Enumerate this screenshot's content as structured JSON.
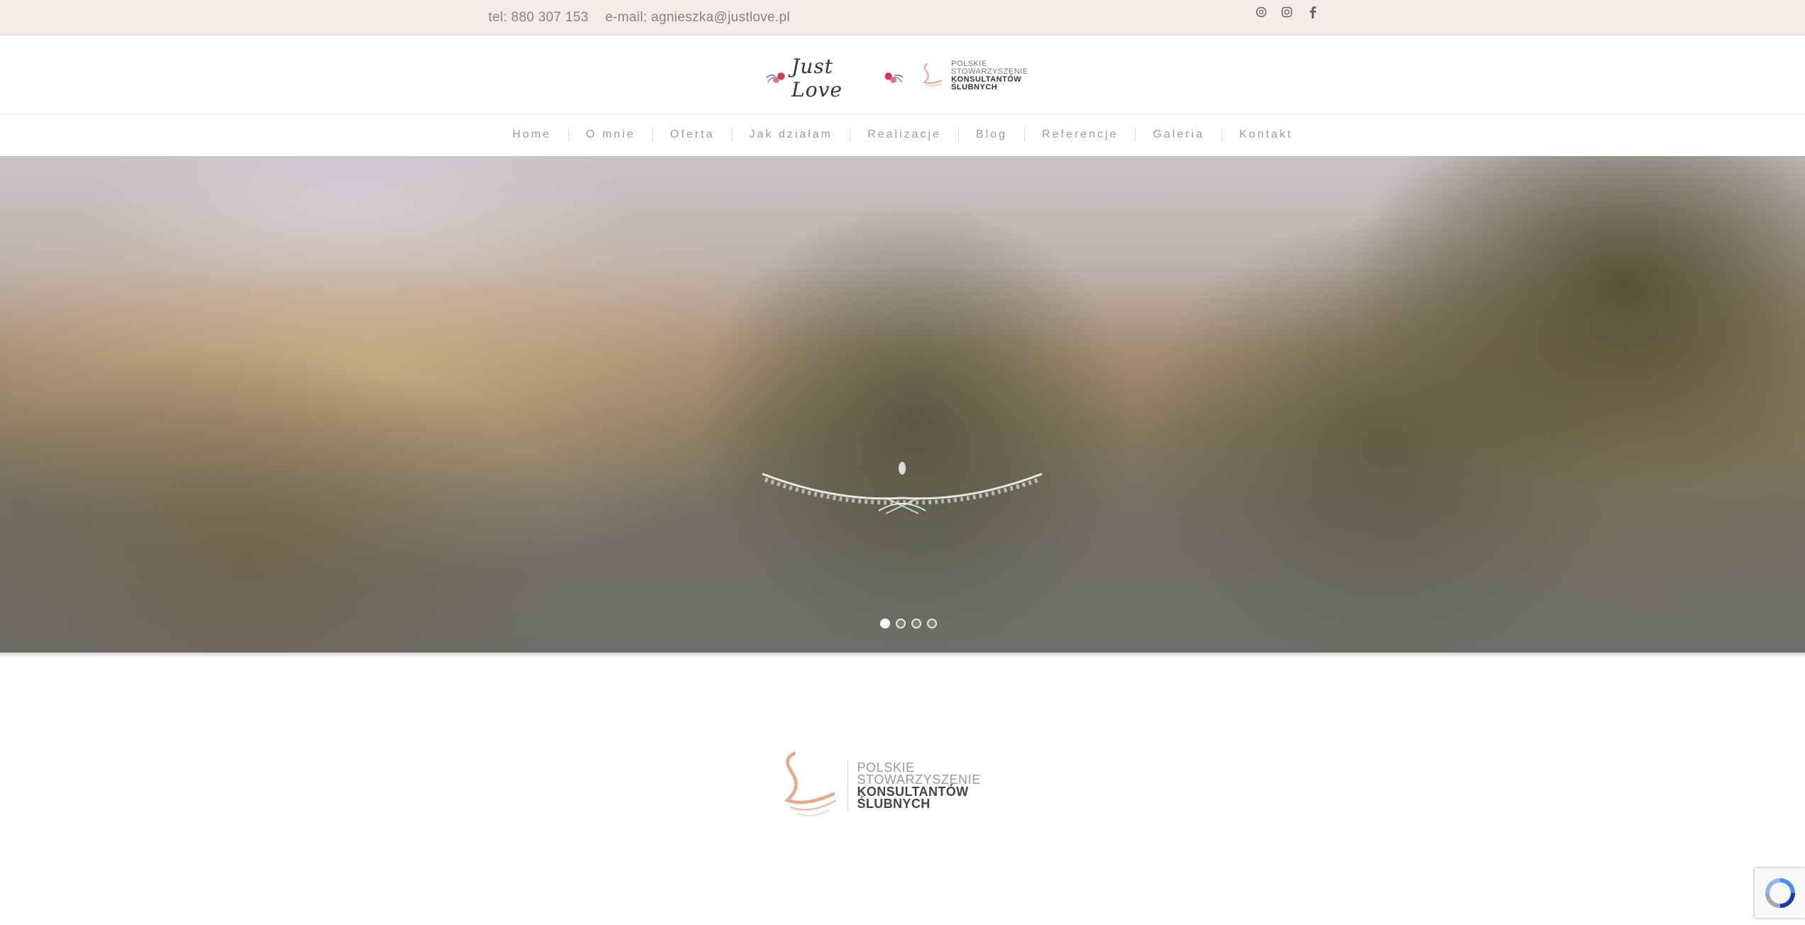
{
  "topbar": {
    "phone": "tel: 880 307 153",
    "email": "e-mail: agnieszka@justlove.pl",
    "social_icons": [
      "globe-icon",
      "instagram-icon",
      "facebook-icon"
    ]
  },
  "header": {
    "logo_text": "Just Love",
    "partner_logo_lines": [
      "POLSKIE STOWARZYSZENIE",
      "KONSULTANTÓW",
      "ŚLUBNYCH"
    ]
  },
  "nav": {
    "items": [
      "Home",
      "O mnie",
      "Oferta",
      "Jak działam",
      "Realizacje",
      "Blog",
      "Referencje",
      "Galeria",
      "Kontakt"
    ]
  },
  "slider": {
    "slide_count": 4,
    "active_index": 0
  },
  "footer_logo": {
    "line1": "POLSKIE STOWARZYSZENIE",
    "line2": "KONSULTANTÓW",
    "line3": "ŚLUBNYCH"
  },
  "colors": {
    "topbar_bg": "#f4ecea",
    "nav_text": "#a09a98",
    "accent": "#d9a78a"
  }
}
